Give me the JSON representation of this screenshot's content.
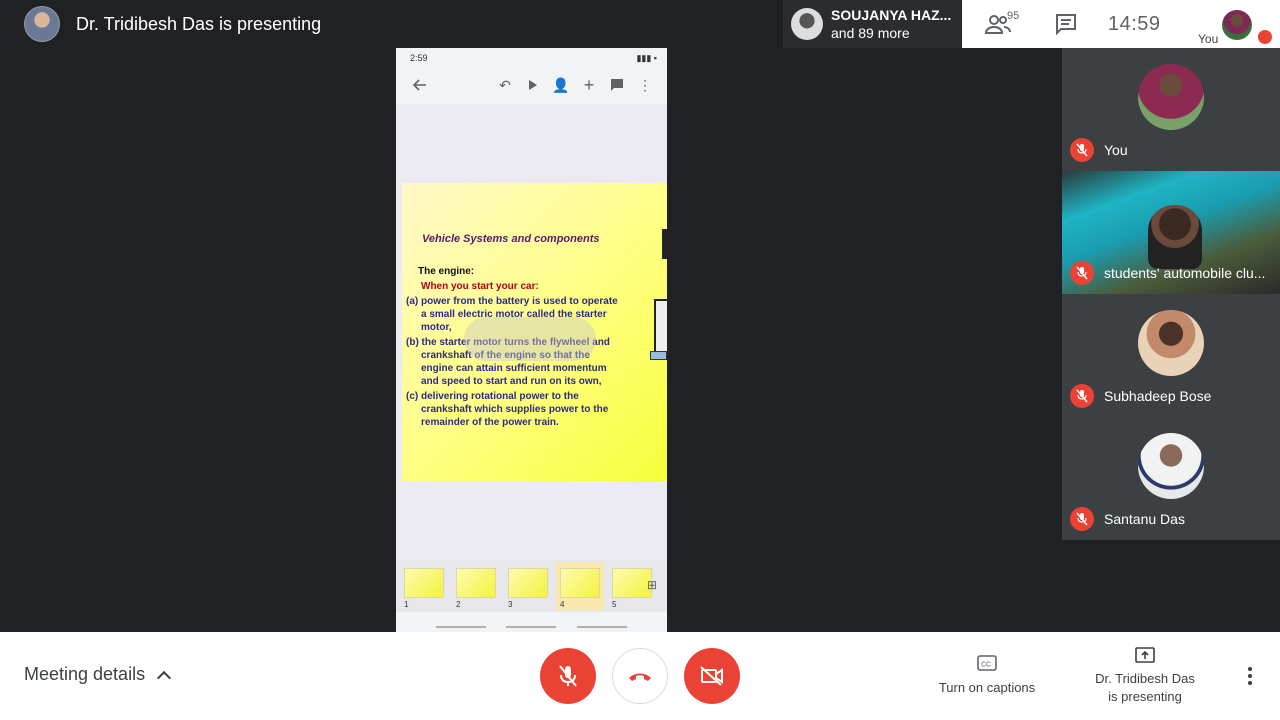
{
  "presenter": {
    "banner": "Dr. Tridibesh Das is presenting"
  },
  "others": {
    "name": "SOUJANYA HAZ...",
    "more": "and 89 more"
  },
  "top": {
    "people_count": "95",
    "clock": "14:59",
    "self_label": "You"
  },
  "phone": {
    "status_time": "2:59",
    "slide": {
      "title": "Vehicle Systems and components",
      "subheading": "The engine:",
      "subheading2": "When you start your car:",
      "items": [
        "(a) power from the battery is used to operate a small electric motor called the starter motor,",
        "(b) the starter motor turns the flywheel and crankshaft of the engine so that the engine can attain sufficient momentum and speed to start and run on its own,",
        "(c) delivering rotational power to the crankshaft which supplies power to the remainder of the power train."
      ]
    },
    "thumbnails": [
      "1",
      "2",
      "3",
      "4",
      "5"
    ],
    "active_thumb": "4"
  },
  "participants": [
    {
      "name": "You"
    },
    {
      "name": "students' automobile clu..."
    },
    {
      "name": "Subhadeep Bose"
    },
    {
      "name": "Santanu Das"
    }
  ],
  "bottom": {
    "meeting_details": "Meeting details",
    "captions": "Turn on captions",
    "presenting_line1": "Dr. Tridibesh Das",
    "presenting_line2": "is presenting"
  },
  "colors": {
    "danger": "#ea4335",
    "background": "#202124",
    "tile": "#3c4043"
  }
}
